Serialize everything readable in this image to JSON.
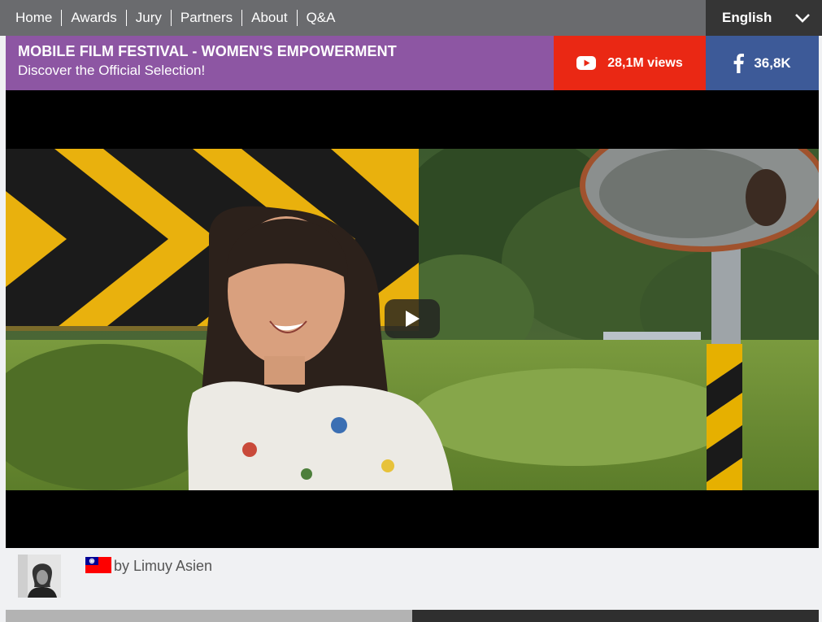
{
  "nav": {
    "links": [
      "Home",
      "Awards",
      "Jury",
      "Partners",
      "About",
      "Q&A"
    ],
    "language": "English"
  },
  "banner": {
    "title": "MOBILE FILM FESTIVAL - WOMEN'S EMPOWERMENT",
    "subtitle": "Discover the Official Selection!",
    "youtube_views": "28,1M views",
    "facebook_count": "36,8K"
  },
  "video": {
    "play_icon": "play-icon"
  },
  "author": {
    "byline": "by Limuy Asien",
    "flag_icon": "taiwan-flag-icon"
  },
  "colors": {
    "nav_bg": "#6a6b6e",
    "banner_purple": "#8d56a3",
    "youtube_red": "#ea2814",
    "facebook_blue": "#3d5a98"
  }
}
